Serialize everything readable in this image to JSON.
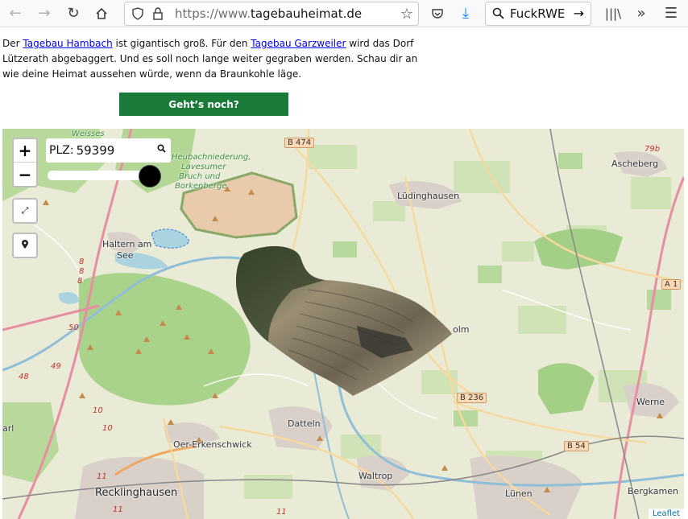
{
  "browser": {
    "url_prefix": "https://www.",
    "url_domain": "tagebauheimat.de",
    "search_text": "FuckRWE"
  },
  "intro": {
    "t1": "Der ",
    "link1": "Tagebau Hambach",
    "t2": " ist gigantisch groß. Für den ",
    "link2": "Tagebau Garzweiler",
    "t3": " wird das Dorf Lützerath abgebaggert. Und es soll noch lange weiter gegraben werden. Schau dir an wie deine Heimat aussehen würde, wenn da Braunkohle läge.",
    "button": "Geht’s noch?"
  },
  "map": {
    "zoom_in": "+",
    "zoom_out": "−",
    "plz_label": "PLZ:",
    "plz_value": "59399",
    "slider_value": 0.95,
    "attribution": "Leaflet",
    "places": {
      "weisses": "Weisses",
      "heubach": "Heubachniederung,",
      "heubach2": "Lavesumer",
      "heubach3": "Bruch und",
      "heubach4": "Borkenberge",
      "haltern": "Haltern am",
      "see": "See",
      "luedinghausen": "Lüdinghausen",
      "ascheberg": "Ascheberg",
      "olm": "olm",
      "datteln": "Datteln",
      "oer": "Oer-Erkenschwick",
      "waltrop": "Waltrop",
      "recklinghausen": "Recklinghausen",
      "luenen": "Lünen",
      "werne": "Werne",
      "bergkamen": "Bergkamen",
      "marl": "arl"
    },
    "roads": {
      "b474": "B 474",
      "b236": "B 236",
      "b54": "B 54",
      "a1": "A 1",
      "r79b": "79b",
      "r8a": "8",
      "r8b": "8",
      "r8c": "8",
      "r50": "50",
      "r49": "49",
      "r48": "48",
      "r10a": "10",
      "r10b": "10",
      "r11a": "11",
      "r11b": "11",
      "r11c": "11"
    }
  }
}
